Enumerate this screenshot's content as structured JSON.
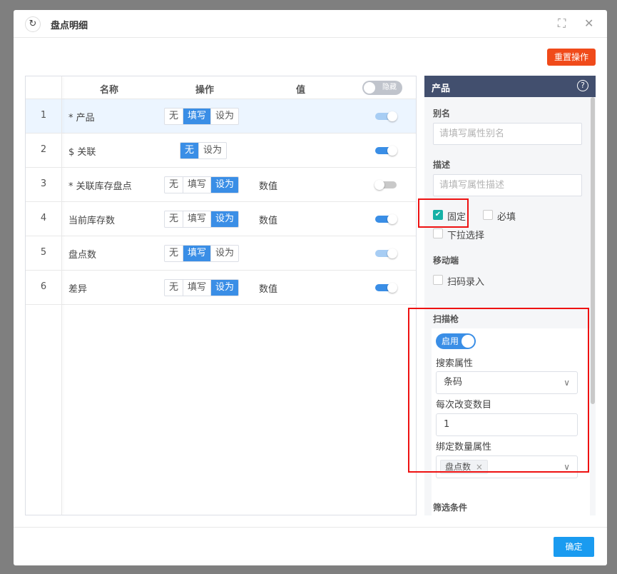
{
  "dialog": {
    "title": "盘点明细",
    "reset_label": "重置操作",
    "ok_label": "确定"
  },
  "table": {
    "columns": [
      "名称",
      "操作",
      "值"
    ],
    "header_toggle": "隐藏",
    "rows": [
      {
        "index": "1",
        "name": "* 产品",
        "options": [
          "无",
          "填写",
          "设为"
        ],
        "active": 1,
        "value": "",
        "toggle": "on-light"
      },
      {
        "index": "2",
        "name": "$ 关联",
        "options": [
          "无",
          "设为"
        ],
        "active": 0,
        "value": "",
        "toggle": "on"
      },
      {
        "index": "3",
        "name": "* 关联库存盘点",
        "options": [
          "无",
          "填写",
          "设为"
        ],
        "active": 2,
        "value": "数值",
        "toggle": "off"
      },
      {
        "index": "4",
        "name": "当前库存数",
        "options": [
          "无",
          "填写",
          "设为"
        ],
        "active": 2,
        "value": "数值",
        "toggle": "on"
      },
      {
        "index": "5",
        "name": "盘点数",
        "options": [
          "无",
          "填写",
          "设为"
        ],
        "active": 1,
        "value": "",
        "toggle": "on-light"
      },
      {
        "index": "6",
        "name": "差异",
        "options": [
          "无",
          "填写",
          "设为"
        ],
        "active": 2,
        "value": "数值",
        "toggle": "on"
      }
    ]
  },
  "panel": {
    "title": "产品",
    "help": "?",
    "alias_label": "别名",
    "alias_placeholder": "请填写属性别名",
    "desc_label": "描述",
    "desc_placeholder": "请填写属性描述",
    "fixed_label": "固定",
    "fixed_checked": true,
    "required_label": "必填",
    "dropdown_label": "下拉选择",
    "mobile_label": "移动端",
    "scan_entry_label": "扫码录入",
    "scanner_label": "扫描枪",
    "enable_label": "启用",
    "search_attr_label": "搜索属性",
    "search_attr_value": "条码",
    "step_label": "每次改变数目",
    "step_value": "1",
    "bind_label": "绑定数量属性",
    "bind_tag": "盘点数",
    "filter_label": "筛选条件"
  }
}
